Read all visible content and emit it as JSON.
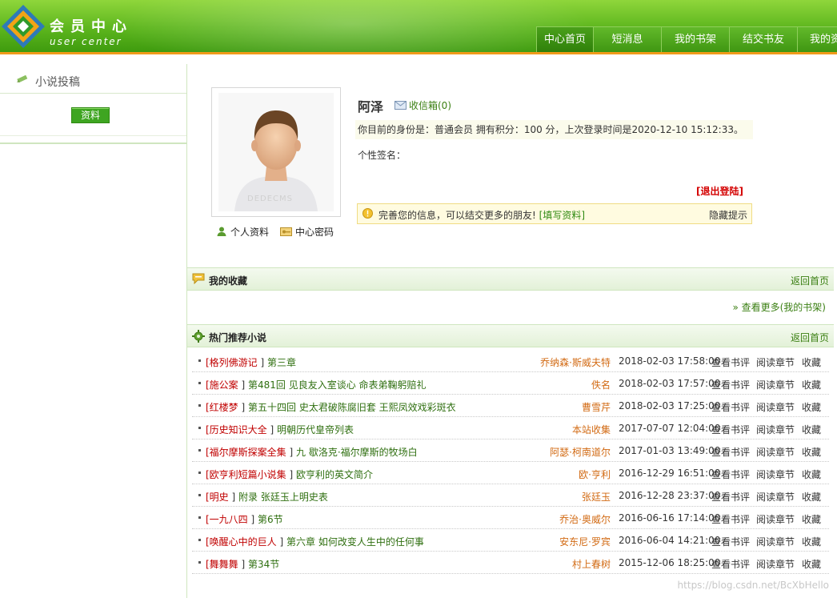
{
  "header": {
    "title_cn": "会员中心",
    "title_en": "user center",
    "nav": [
      {
        "label": "中心首页",
        "active": true
      },
      {
        "label": "短消息"
      },
      {
        "label": "我的书架"
      },
      {
        "label": "结交书友"
      },
      {
        "label": "我的资"
      }
    ]
  },
  "sidebar": {
    "title": "小说投稿",
    "button": "资料"
  },
  "profile": {
    "username": "阿泽",
    "inbox": "收信箱(0)",
    "status": "你目前的身份是：普通会员 拥有积分：100 分，上次登录时间是2020-12-10 15:12:33。",
    "signature": "个性签名：",
    "logout": "[退出登陆]",
    "link_profile": "个人资料",
    "link_password": "中心密码",
    "avatar_watermark": "DEDECMS"
  },
  "notice": {
    "text": "完善您的信息，可以结交更多的朋友!",
    "fill_link": "[填写资料]",
    "hide": "隐藏提示"
  },
  "favorites": {
    "title": "我的收藏",
    "back": "返回首页",
    "more": "» 查看更多(我的书架)"
  },
  "hot": {
    "title": "热门推荐小说",
    "back": "返回首页",
    "actions": [
      "查看书评",
      "阅读章节",
      "收藏"
    ],
    "items": [
      {
        "category": "[格列佛游记",
        "chapter": "第三章",
        "author": "乔纳森·斯威夫特",
        "time": "2018-02-03 17:58:00"
      },
      {
        "category": "[施公案",
        "chapter": "第481回  见良友入室谈心  命表弟鞠躬赔礼",
        "author": "佚名",
        "time": "2018-02-03 17:57:00"
      },
      {
        "category": "[红楼梦",
        "chapter": "第五十四回  史太君破陈腐旧套  王熙凤效戏彩斑衣",
        "author": "曹雪芹",
        "time": "2018-02-03 17:25:00"
      },
      {
        "category": "[历史知识大全",
        "chapter": "明朝历代皇帝列表",
        "author": "本站收集",
        "time": "2017-07-07 12:04:00"
      },
      {
        "category": "[福尔摩斯探案全集",
        "chapter": "九  歇洛克·福尔摩斯的牧场白",
        "author": "阿瑟·柯南道尔",
        "time": "2017-01-03 13:49:00"
      },
      {
        "category": "[欧亨利短篇小说集",
        "chapter": "欧亨利的英文简介",
        "author": "欧·亨利",
        "time": "2016-12-29 16:51:00"
      },
      {
        "category": "[明史",
        "chapter": "附录 张廷玉上明史表",
        "author": "张廷玉",
        "time": "2016-12-28 23:37:00"
      },
      {
        "category": "[一九八四",
        "chapter": "第6节",
        "author": "乔治·奥威尔",
        "time": "2016-06-16 17:14:00"
      },
      {
        "category": "[唤醒心中的巨人",
        "chapter": "第六章  如何改变人生中的任何事",
        "author": "安东尼·罗宾",
        "time": "2016-06-04 14:21:00"
      },
      {
        "category": "[舞舞舞",
        "chapter": "第34节",
        "author": "村上春树",
        "time": "2015-12-06 18:25:00"
      }
    ]
  },
  "watermark": "https://blog.csdn.net/BcXbHello",
  "colors": {
    "header_green": "#5cb51d",
    "accent_orange": "#f19a1a",
    "category_red": "#c00000",
    "author_orange": "#d26a13",
    "link_green": "#3a7f12"
  }
}
